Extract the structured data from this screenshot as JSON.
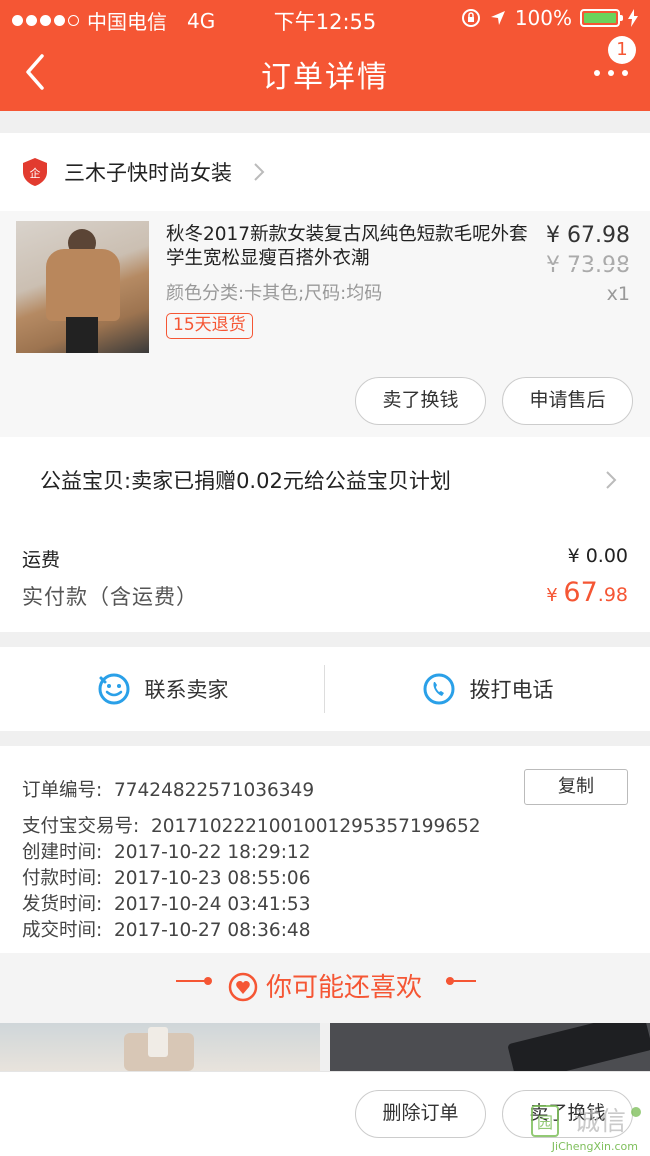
{
  "status_bar": {
    "carrier": "中国电信",
    "network": "4G",
    "time": "下午12:55",
    "battery": "100%",
    "battery_level": 1.0
  },
  "nav": {
    "title": "订单详情",
    "badge_count": "1",
    "back_icon": "chevron-left-icon",
    "more_icon": "more-dots-icon"
  },
  "shop": {
    "name": "三木子快时尚女装",
    "icon": "shop-badge-icon"
  },
  "product": {
    "title": "秋冬2017新款女装复古风纯色短款毛呢外套学生宽松显瘦百搭外衣潮",
    "spec": "颜色分类:卡其色;尺码:均码",
    "tag": "15天退货",
    "price": "¥ 67.98",
    "original_price": "¥ 73.98",
    "quantity": "x1",
    "buttons": [
      "卖了换钱",
      "申请售后"
    ]
  },
  "charity": {
    "text": "公益宝贝:卖家已捐赠0.02元给公益宝贝计划"
  },
  "fees": {
    "shipping_label": "运费",
    "shipping_value": "¥ 0.00",
    "paid_label": "实付款（含运费）",
    "paid_symbol": "¥ ",
    "paid_integer": "67",
    "paid_decimal": ".98"
  },
  "contact": {
    "seller": "联系卖家",
    "phone": "拨打电话"
  },
  "order_info": {
    "copy_label": "复制",
    "lines": [
      "订单编号:  77424822571036349",
      "支付宝交易号:  2017102221001001295357199652",
      "创建时间:  2017-10-22 18:29:12",
      "付款时间:  2017-10-23 08:55:06",
      "发货时间:  2017-10-24 03:41:53",
      "成交时间:  2017-10-27 08:36:48"
    ]
  },
  "recommend": {
    "title": "你可能还喜欢"
  },
  "footer": {
    "delete_label": "删除订单",
    "sell_label": "卖了换钱"
  },
  "watermark": {
    "text": "JiChengXin.com",
    "logo_text": "诚信"
  },
  "colors": {
    "brand": "#f55634",
    "battery": "#6ad35c",
    "seller_icon": "#2aa0e8"
  }
}
